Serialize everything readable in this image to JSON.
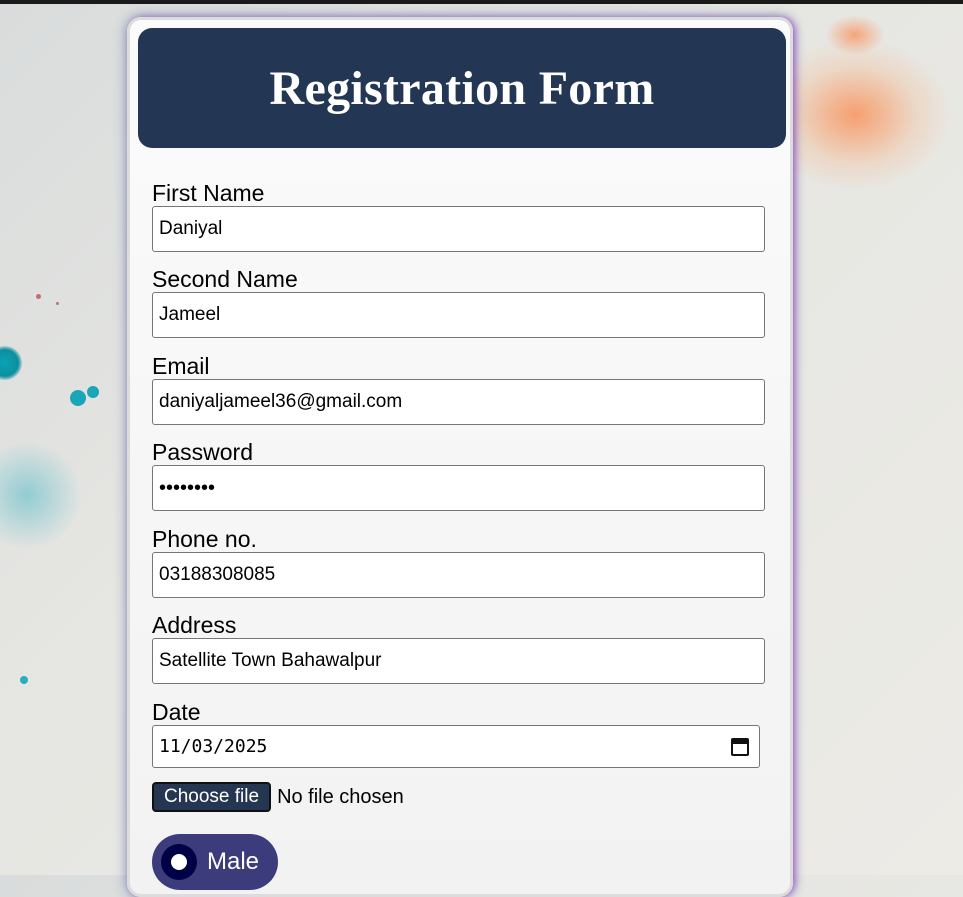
{
  "form": {
    "title": "Registration Form",
    "fields": [
      {
        "label": "First Name",
        "value": "Daniyal"
      },
      {
        "label": "Second Name",
        "value": "Jameel"
      },
      {
        "label": "Email",
        "value": "daniyaljameel36@gmail.com"
      },
      {
        "label": "Password",
        "value": "••••••••"
      },
      {
        "label": "Phone no.",
        "value": "03188308085"
      },
      {
        "label": "Address",
        "value": "Satellite Town Bahawalpur"
      },
      {
        "label": "Date",
        "value": "11/03/2025"
      }
    ],
    "file": {
      "button_label": "Choose file",
      "status": "No file chosen"
    },
    "gender": {
      "selected_label": "Male"
    }
  },
  "colors": {
    "header_bg": "#233654",
    "radio_pill_bg": "#3c3c7c",
    "radio_dot": "#000047"
  },
  "icons": {
    "date_picker": "calendar-icon"
  }
}
